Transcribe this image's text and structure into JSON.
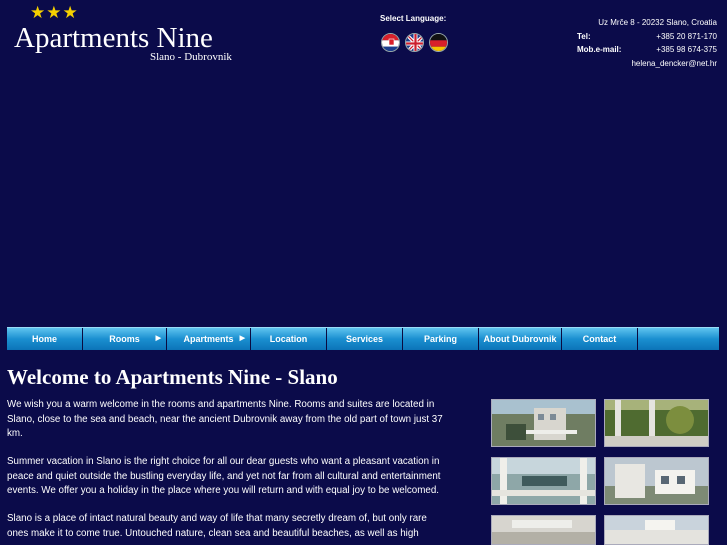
{
  "header": {
    "stars": "★★★",
    "title": "Apartments Nine",
    "subtitle": "Slano - Dubrovnik"
  },
  "language": {
    "label": "Select Language:",
    "flags": [
      "croatian-flag-icon",
      "english-flag-icon",
      "german-flag-icon"
    ]
  },
  "contact": {
    "address": "Uz Mrče 8 - 20232 Slano, Croatia",
    "tel_label": "Tel:",
    "tel": "+385 20 871-170",
    "mob_label": "Mob.e-mail:",
    "mob": "+385 98 674-375",
    "email": "helena_dencker@net.hr"
  },
  "nav": {
    "items": [
      {
        "label": "Home"
      },
      {
        "label": "Rooms",
        "arrow": "▶"
      },
      {
        "label": "Apartments",
        "arrow": "▶"
      },
      {
        "label": "Location"
      },
      {
        "label": "Services"
      },
      {
        "label": "Parking"
      },
      {
        "label": "About Dubrovnik"
      },
      {
        "label": "Contact"
      }
    ]
  },
  "main": {
    "heading": "Welcome to Apartments Nine - Slano",
    "p1": "We wish you a warm welcome in the rooms and apartments Nine. Rooms and suites are located in Slano, close to the sea and beach, near the ancient Dubrovnik away from the old part of town just 37 km.",
    "p2": "Summer vacation in Slano is the right choice for all our dear guests who want a pleasant vacation in peace and quiet outside the bustling everyday life, and yet not far from all cultural and entertainment events. We offer you a holiday in the place where you will return and with equal joy to be welcomed.",
    "p3": "Slano is a place of intact natural beauty and way of life that many secretly dream of, but only rare ones make it to come true. Untouched nature, clean sea and beautiful beaches, as well as high"
  },
  "colors": {
    "background": "#0b0b4a",
    "nav_gradient_top": "#5fc4ef",
    "nav_gradient_bottom": "#0c74b8",
    "stars": "#f5d000"
  }
}
